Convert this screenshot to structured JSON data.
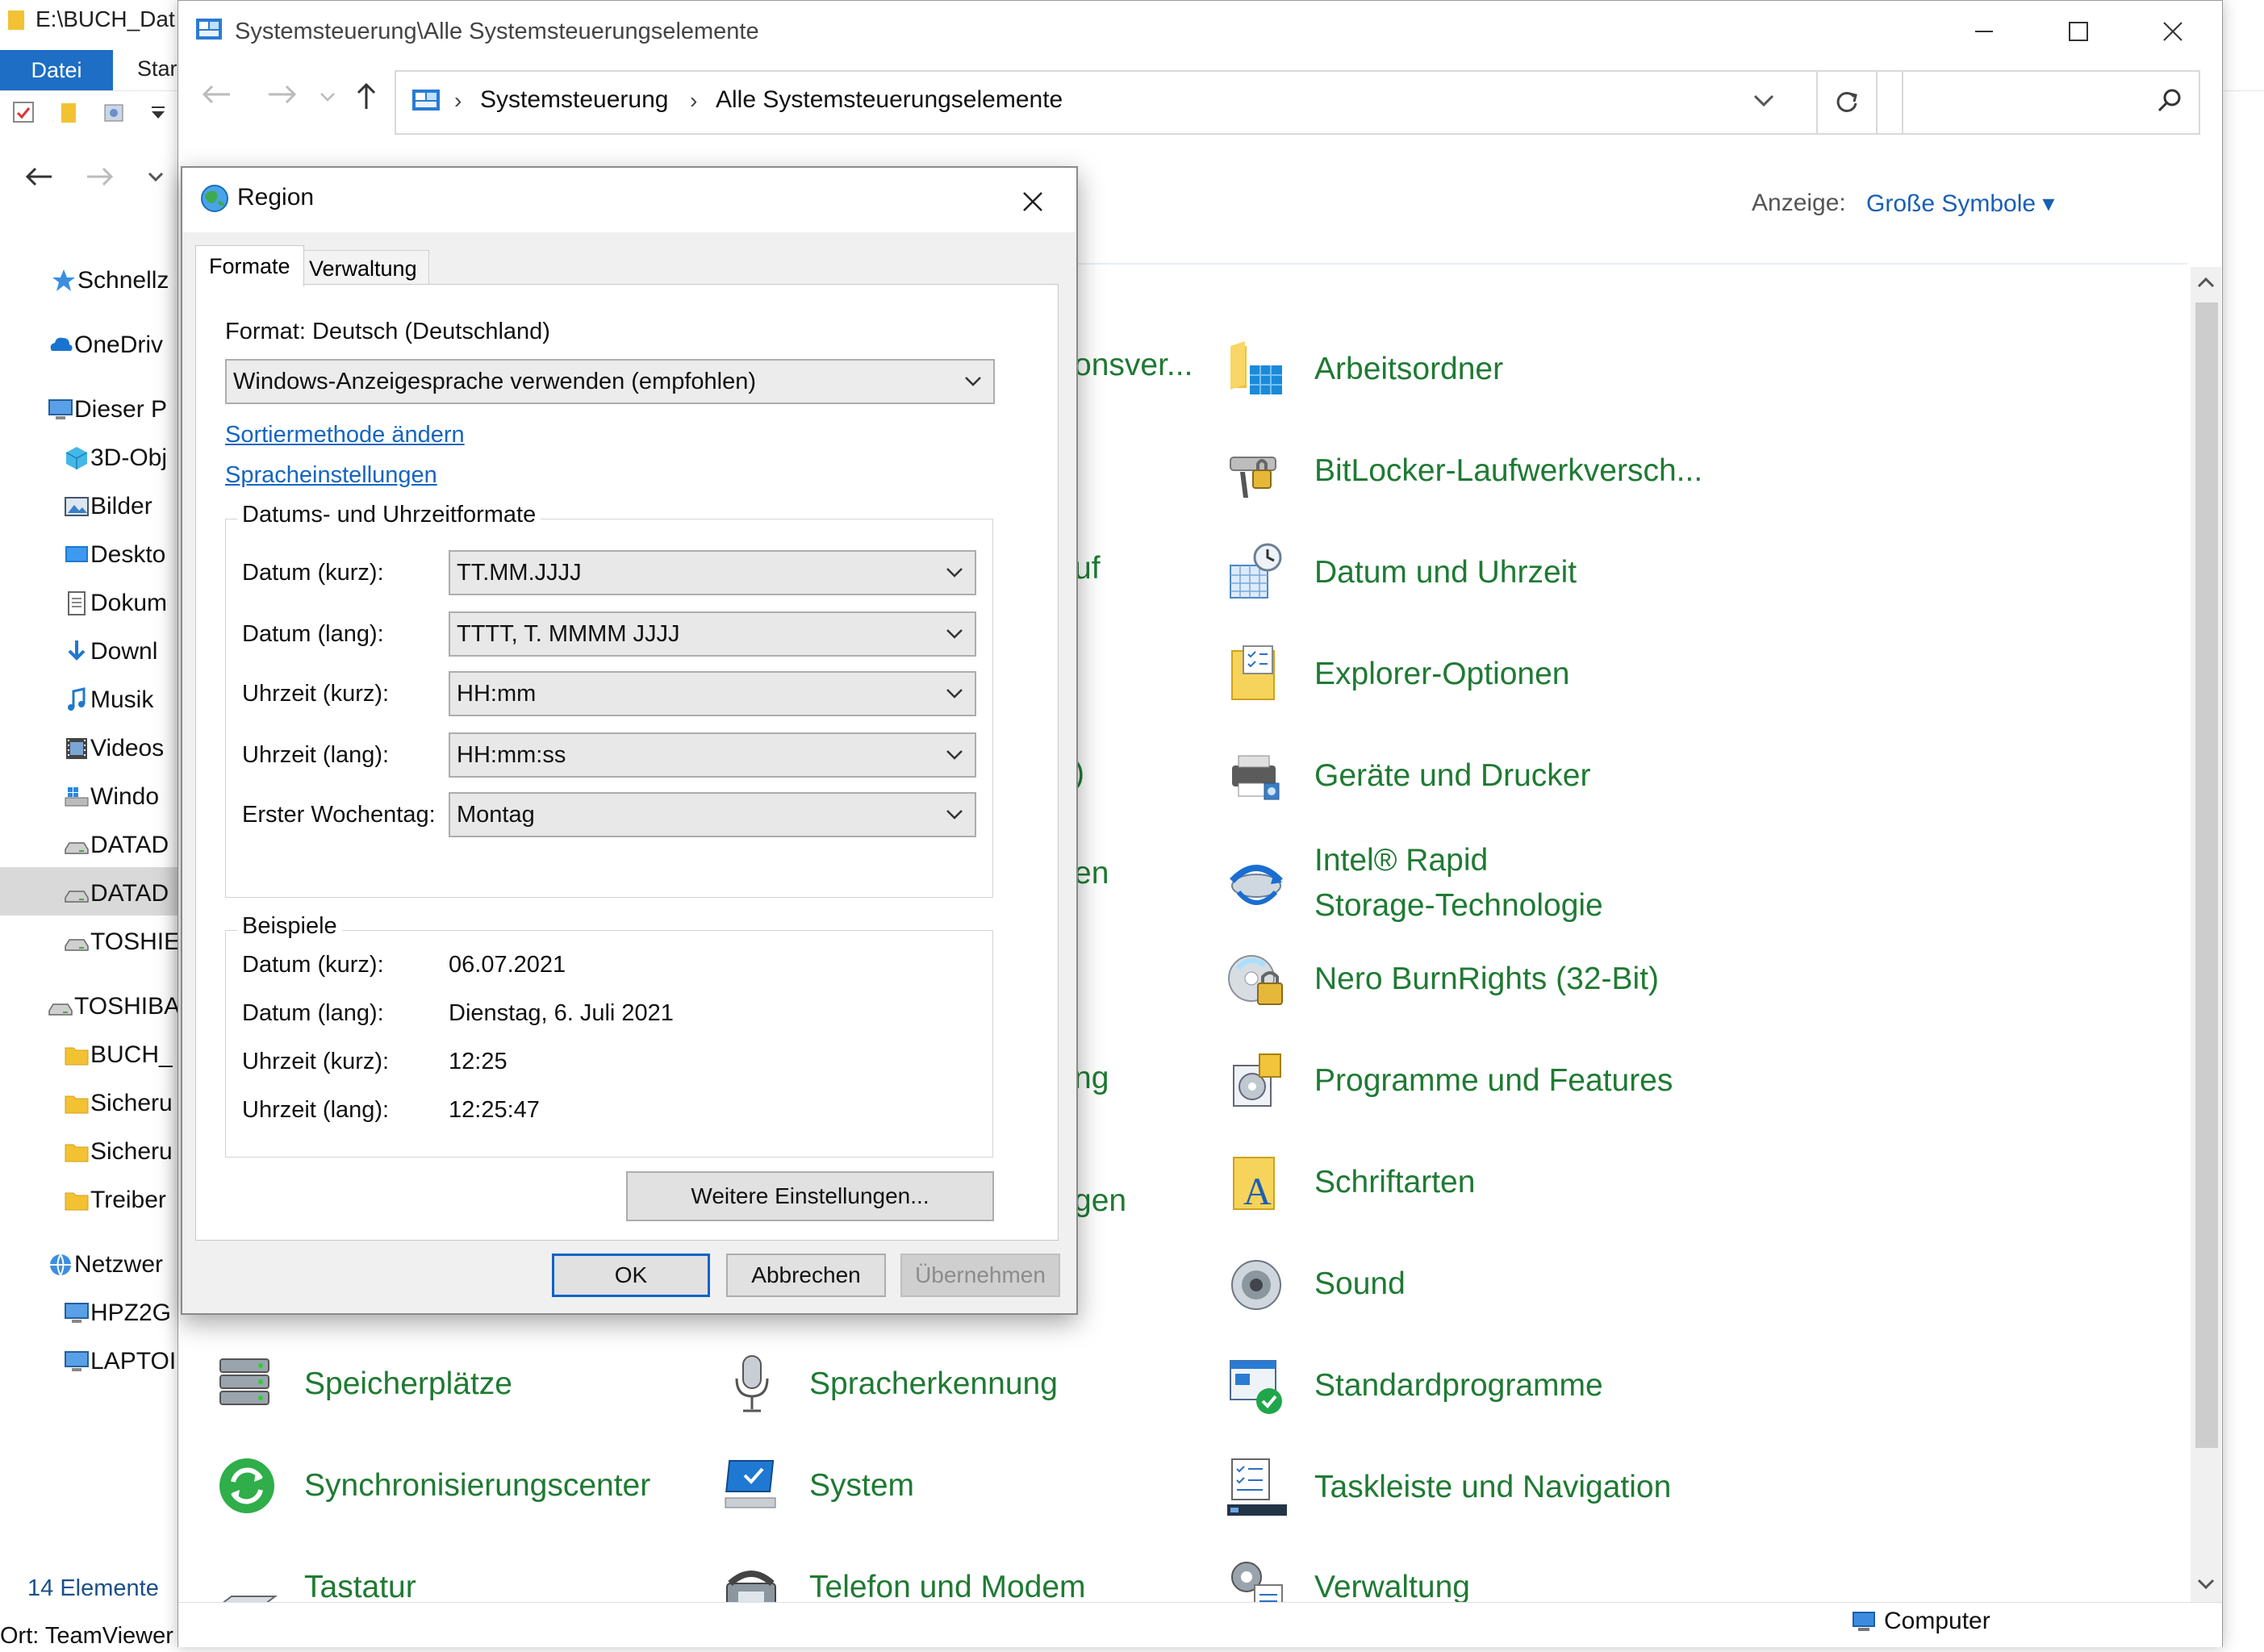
{
  "explorer": {
    "title": "E:\\BUCH_Dat",
    "ribbon": {
      "file_tab": "Datei",
      "start_tab": "Star"
    },
    "nav_items": [
      {
        "label": "Schnellz",
        "icon": "star-icon"
      },
      {
        "label": "OneDriv",
        "icon": "cloud-icon"
      },
      {
        "label": "Dieser P",
        "icon": "computer-icon"
      },
      {
        "label": "3D-Obj",
        "icon": "cube-icon"
      },
      {
        "label": "Bilder",
        "icon": "pictures-icon"
      },
      {
        "label": "Deskto",
        "icon": "desktop-icon"
      },
      {
        "label": "Dokum",
        "icon": "document-icon"
      },
      {
        "label": "Downl",
        "icon": "download-icon"
      },
      {
        "label": "Musik",
        "icon": "music-icon"
      },
      {
        "label": "Videos",
        "icon": "video-icon"
      },
      {
        "label": "Windo",
        "icon": "windows-drive-icon"
      },
      {
        "label": "DATAD",
        "icon": "drive-icon"
      },
      {
        "label": "DATAD",
        "icon": "drive-icon"
      },
      {
        "label": "TOSHIE",
        "icon": "drive-icon"
      },
      {
        "label": "TOSHIBA",
        "icon": "drive-icon"
      },
      {
        "label": "BUCH_",
        "icon": "folder-icon"
      },
      {
        "label": "Sicheru",
        "icon": "folder-icon"
      },
      {
        "label": "Sicheru",
        "icon": "folder-icon"
      },
      {
        "label": "Treiber",
        "icon": "folder-icon"
      },
      {
        "label": "Netzwer",
        "icon": "network-icon"
      },
      {
        "label": "HPZ2G",
        "icon": "computer-icon"
      },
      {
        "label": "LAPTOI",
        "icon": "computer-icon"
      }
    ],
    "item_count": "14 Elemente",
    "location_footer": "Ort: TeamViewer"
  },
  "control_panel": {
    "title": "Systemsteuerung\\Alle Systemsteuerungselemente",
    "breadcrumb": [
      "Systemsteuerung",
      "Alle Systemsteuerungselemente"
    ],
    "search_placeholder": "",
    "view_label": "Anzeige:",
    "view_value": "Große Symbole ▾",
    "status_location": "Computer",
    "clipped_left_labels": [
      "onsver...",
      "uf",
      ")",
      "en",
      "ng",
      "gen"
    ],
    "right_column": [
      {
        "label": "Arbeitsordner",
        "icon": "work-folders-icon"
      },
      {
        "label": "BitLocker-Laufwerkversch...",
        "icon": "bitlocker-icon"
      },
      {
        "label": "Datum und Uhrzeit",
        "icon": "date-time-icon"
      },
      {
        "label": "Explorer-Optionen",
        "icon": "explorer-options-icon"
      },
      {
        "label": "Geräte und Drucker",
        "icon": "devices-printers-icon"
      },
      {
        "label": "Intel® Rapid",
        "label2": "Storage-Technologie",
        "icon": "intel-rst-icon"
      },
      {
        "label": "Nero BurnRights (32-Bit)",
        "icon": "nero-icon"
      },
      {
        "label": "Programme und Features",
        "icon": "programs-features-icon"
      },
      {
        "label": "Schriftarten",
        "icon": "fonts-icon"
      },
      {
        "label": "Sound",
        "icon": "sound-icon"
      },
      {
        "label": "Standardprogramme",
        "icon": "default-programs-icon"
      },
      {
        "label": "Taskleiste und Navigation",
        "icon": "taskbar-icon"
      },
      {
        "label": "Verwaltung",
        "icon": "admin-tools-icon"
      }
    ],
    "bottom_rows": [
      [
        {
          "label": "Speicherplätze",
          "icon": "storage-spaces-icon"
        },
        {
          "label": "Spracherkennung",
          "icon": "microphone-icon"
        }
      ],
      [
        {
          "label": "Synchronisierungscenter",
          "icon": "sync-center-icon"
        },
        {
          "label": "System",
          "icon": "system-icon"
        }
      ],
      [
        {
          "label": "Tastatur",
          "icon": "keyboard-icon"
        },
        {
          "label": "Telefon und Modem",
          "icon": "phone-modem-icon"
        }
      ]
    ]
  },
  "region_dialog": {
    "title": "Region",
    "tabs": [
      "Formate",
      "Verwaltung"
    ],
    "format_label": "Format: Deutsch (Deutschland)",
    "format_dropdown": "Windows-Anzeigesprache verwenden (empfohlen)",
    "links": [
      "Sortiermethode ändern",
      "Spracheinstellungen"
    ],
    "formats_group_title": "Datums- und Uhrzeitformate",
    "format_rows": [
      {
        "label": "Datum (kurz):",
        "value": "TT.MM.JJJJ"
      },
      {
        "label": "Datum (lang):",
        "value": "TTTT, T. MMMM JJJJ"
      },
      {
        "label": "Uhrzeit (kurz):",
        "value": "HH:mm"
      },
      {
        "label": "Uhrzeit (lang):",
        "value": "HH:mm:ss"
      },
      {
        "label": "Erster Wochentag:",
        "value": "Montag"
      }
    ],
    "examples_group_title": "Beispiele",
    "examples": [
      {
        "label": "Datum (kurz):",
        "value": "06.07.2021"
      },
      {
        "label": "Datum (lang):",
        "value": "Dienstag, 6. Juli 2021"
      },
      {
        "label": "Uhrzeit (kurz):",
        "value": "12:25"
      },
      {
        "label": "Uhrzeit (lang):",
        "value": "12:25:47"
      }
    ],
    "buttons": {
      "more": "Weitere Einstellungen...",
      "ok": "OK",
      "cancel": "Abbrechen",
      "apply": "Übernehmen"
    }
  },
  "colors": {
    "accent": "#1d6ec4",
    "link": "#1565c0",
    "cp_item_text": "#1f7a33",
    "ok_border": "#0a64c8"
  }
}
